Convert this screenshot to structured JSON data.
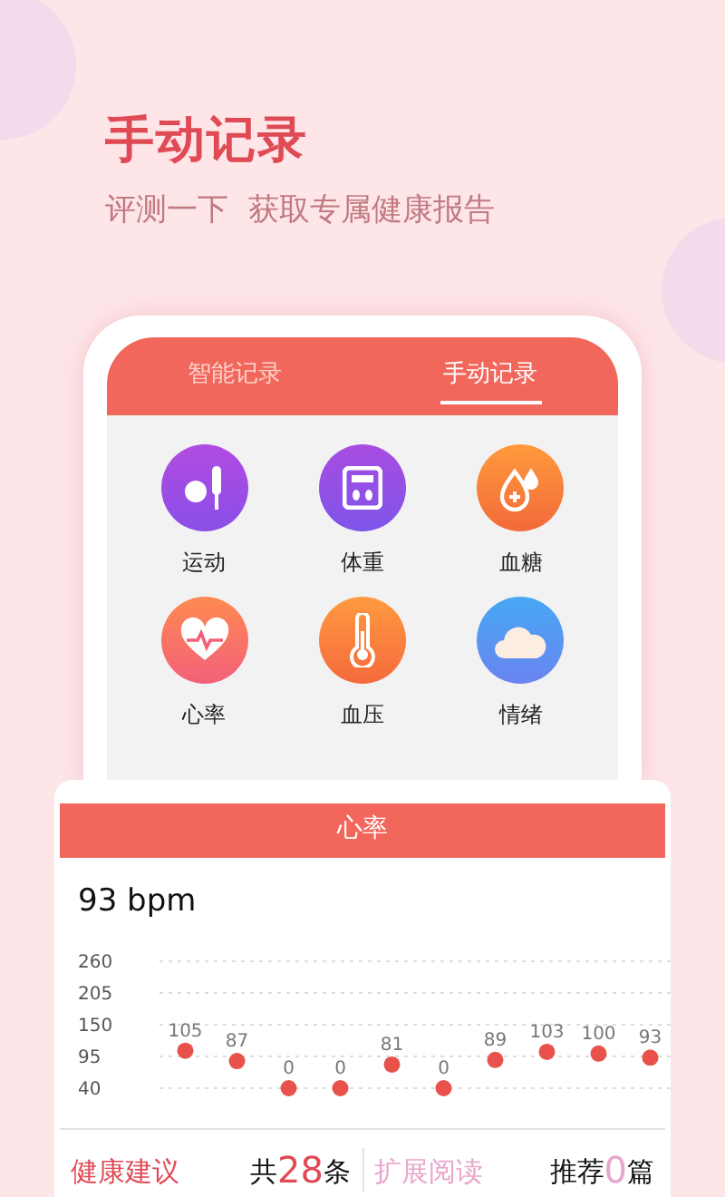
{
  "hero": {
    "title": "手动记录",
    "subtitle": "评测一下  获取专属健康报告"
  },
  "tabs": [
    {
      "label": "智能记录",
      "selected": false
    },
    {
      "label": "手动记录",
      "selected": true
    }
  ],
  "categories": [
    {
      "label": "运动",
      "kind": "sport"
    },
    {
      "label": "体重",
      "kind": "weight"
    },
    {
      "label": "血糖",
      "kind": "sugar"
    },
    {
      "label": "心率",
      "kind": "heart"
    },
    {
      "label": "血压",
      "kind": "pressure"
    },
    {
      "label": "情绪",
      "kind": "mood"
    }
  ],
  "detail": {
    "title": "心率",
    "reading": "93 bpm",
    "chart_data": {
      "type": "scatter",
      "ylim": [
        40,
        260
      ],
      "grid": true,
      "yticks": [
        40,
        95,
        150,
        205,
        260
      ],
      "value_labels": [
        "105",
        "87",
        "0",
        "0",
        "81",
        "0",
        "89",
        "103",
        "100",
        "93"
      ],
      "series": [
        {
          "color": "#e8524a",
          "values": [
            105,
            87,
            40,
            40,
            81,
            40,
            89,
            103,
            100,
            93
          ]
        }
      ]
    },
    "advice": {
      "label": "健康建议",
      "prefix": "共",
      "count": "28",
      "suffix": "条"
    },
    "reading_more": {
      "label": "扩展阅读",
      "prefix": "推荐",
      "count": "0",
      "suffix": "篇"
    }
  }
}
